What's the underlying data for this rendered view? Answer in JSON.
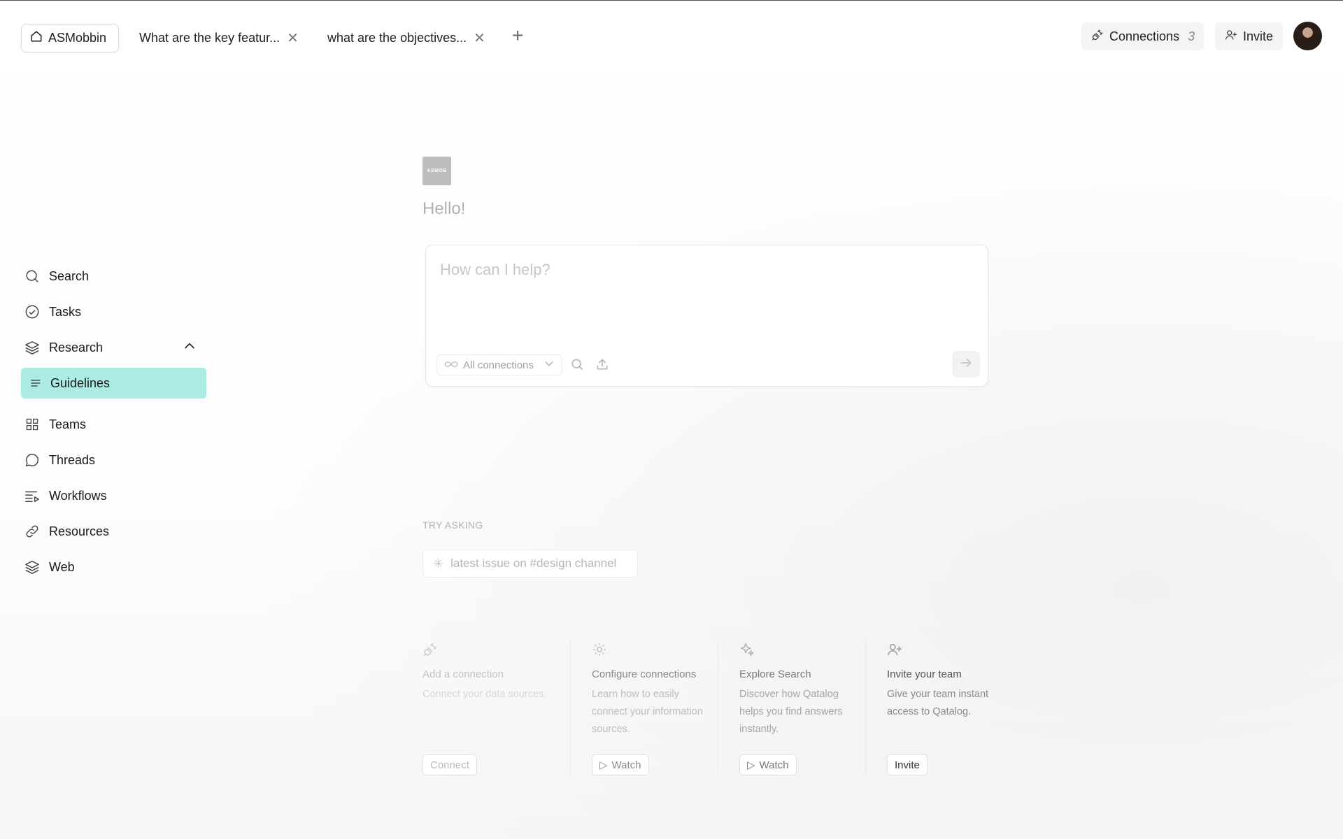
{
  "tabs": {
    "home_label": "ASMobbin",
    "items": [
      {
        "label": "What are the key featur..."
      },
      {
        "label": "what are the objectives..."
      }
    ]
  },
  "header": {
    "connections_label": "Connections",
    "connections_count": "3",
    "invite_label": "Invite"
  },
  "sidebar": {
    "items": [
      {
        "label": "Search",
        "icon": "search-icon"
      },
      {
        "label": "Tasks",
        "icon": "check-circle-icon"
      },
      {
        "label": "Research",
        "icon": "layers-icon"
      },
      {
        "label": "Guidelines",
        "icon": "lines-icon"
      },
      {
        "label": "Teams",
        "icon": "grid-icon"
      },
      {
        "label": "Threads",
        "icon": "chat-bubble-icon"
      },
      {
        "label": "Workflows",
        "icon": "playlist-icon"
      },
      {
        "label": "Resources",
        "icon": "link-icon"
      },
      {
        "label": "Web",
        "icon": "layers-icon"
      }
    ]
  },
  "main": {
    "greeting": "Hello!",
    "logo_text": "ASMOB",
    "prompt_placeholder": "How can I help?",
    "connections_filter": "All connections",
    "try_asking_label": "TRY ASKING",
    "suggestion": "latest issue on #design channel",
    "cards": [
      {
        "title": "Add a connection",
        "desc": "Connect your data sources.",
        "button": "Connect",
        "icon": "plug-icon"
      },
      {
        "title": "Configure connections",
        "desc": "Learn how to easily connect your information sources.",
        "button": "Watch",
        "icon": "gear-icon"
      },
      {
        "title": "Explore Search",
        "desc": "Discover how Qatalog helps you find answers instantly.",
        "button": "Watch",
        "icon": "sparkle-icon"
      },
      {
        "title": "Invite your team",
        "desc": "Give your team instant access to Qatalog.",
        "button": "Invite",
        "icon": "add-user-icon"
      }
    ]
  },
  "colors": {
    "active_nav": "#abebe4"
  }
}
